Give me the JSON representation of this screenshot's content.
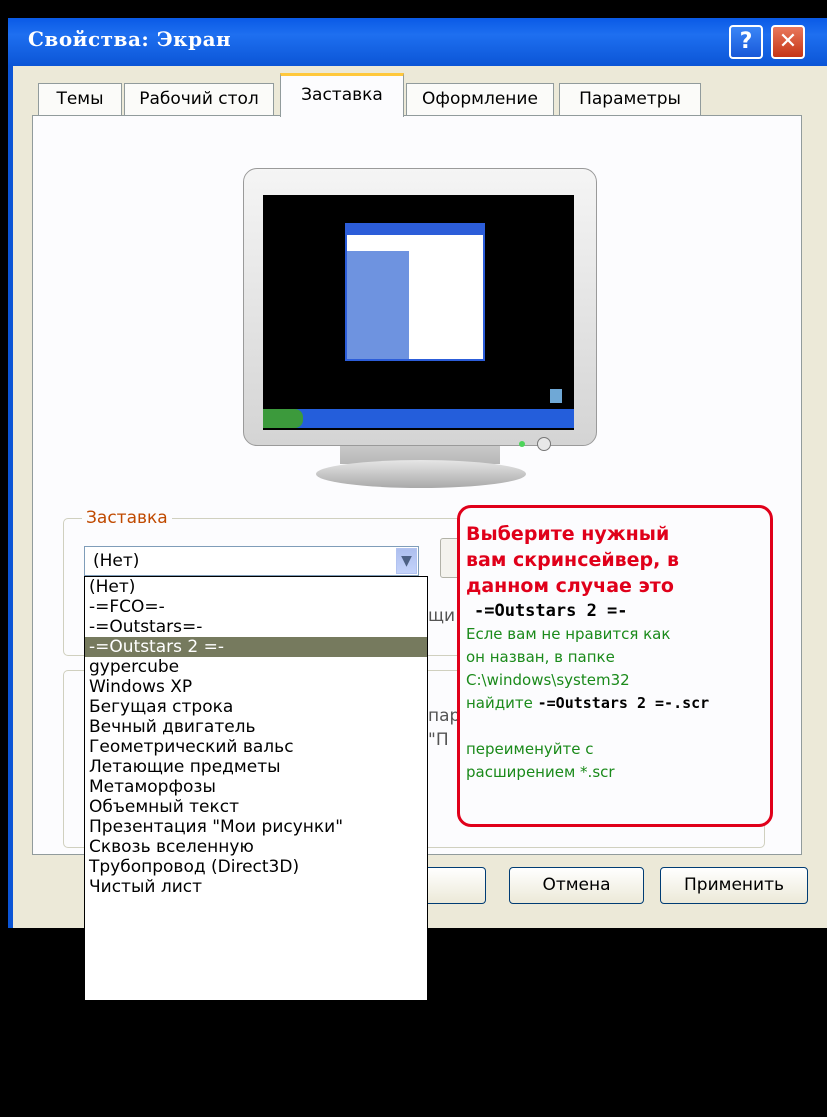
{
  "window": {
    "title": "Свойства: Экран",
    "help_label": "?",
    "close_label": "✕"
  },
  "tabs": [
    {
      "label": "Темы"
    },
    {
      "label": "Рабочий стол"
    },
    {
      "label": "Заставка",
      "active": true
    },
    {
      "label": "Оформление"
    },
    {
      "label": "Параметры"
    }
  ],
  "screensaver": {
    "group_label": "Заставка",
    "selected_value": "(Нет)",
    "options": [
      "(Нет)",
      "-=FCO=-",
      "-=Outstars=-",
      "-=Outstars 2 =-",
      "gypercube",
      "Windows XP",
      "Бегущая строка",
      "Вечный двигатель",
      "Геометрический вальс",
      "Летающие предметы",
      "Метаморфозы",
      "Объемный текст",
      "Презентация \"Мои рисунки\"",
      "Сквозь вселенную",
      "Трубопровод (Direct3D)",
      "Чистый лист"
    ],
    "highlighted_option": "-=Outstars 2 =-",
    "obscured_text_1": "щи",
    "obscured_text_2": "пар",
    "obscured_text_3": "\"П"
  },
  "buttons": {
    "ok_label": "",
    "cancel_label": "Отмена",
    "apply_label": "Применить"
  },
  "callout": {
    "heading_line1": "Выберите нужный",
    "heading_line2": "вам скринсейвер, в",
    "heading_line3": "данном случае это",
    "name": "-=Outstars 2 =-",
    "note_line1": "Есле вам не нравится как",
    "note_line2": "он назван, в папке",
    "note_line3": "C:\\windows\\system32",
    "note_line4_prefix": "найдите ",
    "note_line4_name": "-=Outstars 2 =-.scr",
    "note_line5": "переименуйте с",
    "note_line6": "расширением *.scr"
  },
  "colors": {
    "titlebar": "#0b55d6",
    "callout_red": "#e0001a",
    "callout_green": "#1a8a1a",
    "selected_option_bg": "#767a5e",
    "group_label": "#c04a00"
  }
}
